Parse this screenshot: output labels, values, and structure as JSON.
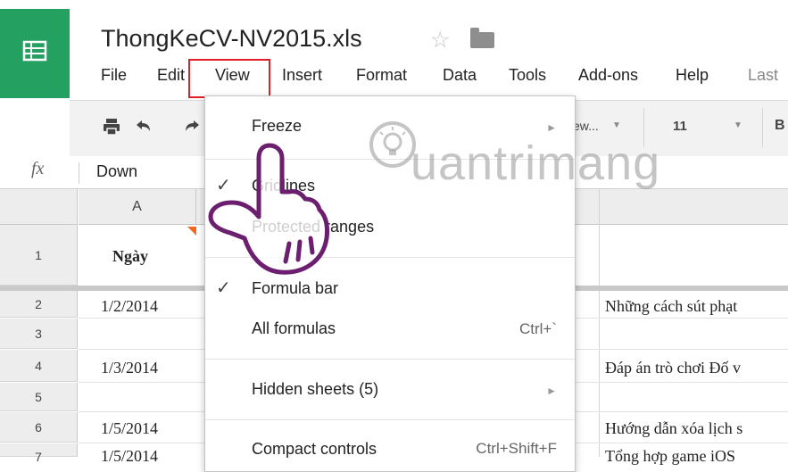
{
  "app": {
    "file_title": "ThongKeCV-NV2015.xls",
    "menus": [
      "File",
      "Edit",
      "View",
      "Insert",
      "Format",
      "Data",
      "Tools",
      "Add-ons",
      "Help",
      "Last"
    ]
  },
  "toolbar": {
    "font_name": "ew...",
    "font_size": "11",
    "bold_label": "B"
  },
  "formula_bar": {
    "fx_label": "fx",
    "value": "Down"
  },
  "grid": {
    "column_a": "A",
    "rows": [
      {
        "num": "1",
        "a": "Ngày",
        "right": ""
      },
      {
        "num": "2",
        "a": "1/2/2014",
        "right": "Những cách sút phạt"
      },
      {
        "num": "3",
        "a": "",
        "right": ""
      },
      {
        "num": "4",
        "a": "1/3/2014",
        "right": "Đáp án trò chơi Đố v"
      },
      {
        "num": "5",
        "a": "",
        "right": ""
      },
      {
        "num": "6",
        "a": "1/5/2014",
        "right": "Hướng dẫn xóa lịch s"
      },
      {
        "num": "7",
        "a": "1/5/2014",
        "right": "Tổng hợp game iOS"
      }
    ]
  },
  "view_menu": {
    "items": [
      {
        "label": "Freeze",
        "shortcut": "",
        "checked": false,
        "submenu": true
      },
      {
        "label": "Gridlines",
        "shortcut": "",
        "checked": true,
        "submenu": false
      },
      {
        "label": "Protected ranges",
        "shortcut": "",
        "checked": false,
        "submenu": false
      },
      {
        "label": "Formula bar",
        "shortcut": "",
        "checked": true,
        "submenu": false
      },
      {
        "label": "All formulas",
        "shortcut": "Ctrl+`",
        "checked": false,
        "submenu": false
      },
      {
        "label": "Hidden sheets (5)",
        "shortcut": "",
        "checked": false,
        "submenu": true
      },
      {
        "label": "Compact controls",
        "shortcut": "Ctrl+Shift+F",
        "checked": false,
        "submenu": false
      }
    ]
  },
  "watermark": {
    "text": "uantrimang"
  },
  "colors": {
    "brand_green": "#24a160",
    "highlight_red": "#e21f26",
    "hand_outline": "#6b1f6e"
  }
}
